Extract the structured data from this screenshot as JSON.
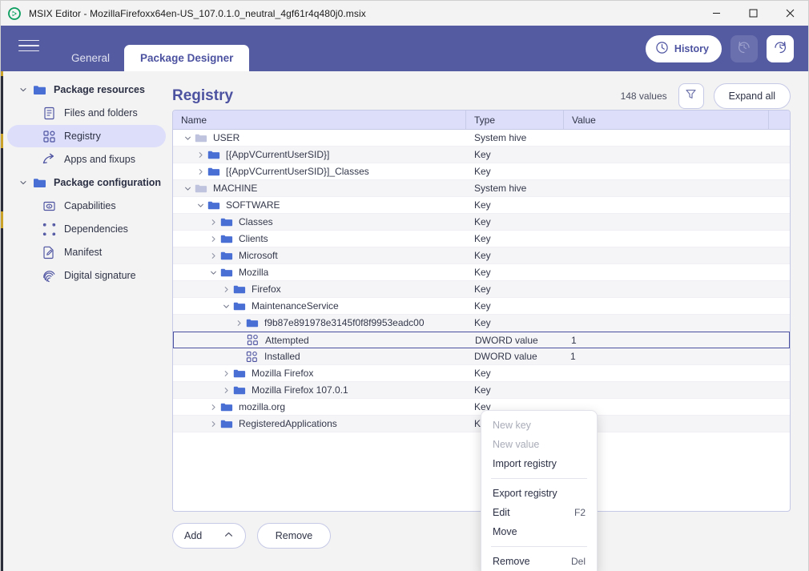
{
  "window": {
    "app_icon": "msix-logo-icon",
    "title": "MSIX Editor - MozillaFirefoxx64en-US_107.0.1.0_neutral_4gf61r4q480j0.msix",
    "minimize_label": "minimize-icon",
    "maximize_label": "maximize-icon",
    "close_label": "close-icon"
  },
  "header": {
    "menu_icon": "hamburger-icon",
    "tabs": [
      {
        "label": "General",
        "active": false
      },
      {
        "label": "Package Designer",
        "active": true
      }
    ],
    "history_label": "History",
    "history_icon": "clock-icon",
    "undo_icon": "undo-icon",
    "redo_icon": "redo-icon"
  },
  "sidebar": {
    "items": [
      {
        "label": "Package resources",
        "type": "group",
        "icon": "folder-icon",
        "expanded": true,
        "active": false
      },
      {
        "label": "Files and folders",
        "type": "child",
        "icon": "document-icon",
        "active": false
      },
      {
        "label": "Registry",
        "type": "child",
        "icon": "registry-icon",
        "active": true
      },
      {
        "label": "Apps and fixups",
        "type": "child",
        "icon": "arrow-branch-icon",
        "active": false
      },
      {
        "label": "Package configuration",
        "type": "group",
        "icon": "folder-icon",
        "expanded": true,
        "active": false
      },
      {
        "label": "Capabilities",
        "type": "child",
        "icon": "capabilities-icon",
        "active": false
      },
      {
        "label": "Dependencies",
        "type": "child",
        "icon": "dependencies-icon",
        "active": false
      },
      {
        "label": "Manifest",
        "type": "child",
        "icon": "manifest-edit-icon",
        "active": false
      },
      {
        "label": "Digital signature",
        "type": "child",
        "icon": "fingerprint-icon",
        "active": false
      }
    ]
  },
  "main": {
    "title": "Registry",
    "count_label": "148 values",
    "filter_icon": "funnel-icon",
    "expand_all_label": "Expand all",
    "columns": [
      "Name",
      "Type",
      "Value"
    ],
    "rows": [
      {
        "name": "USER",
        "type": "System hive",
        "value": "",
        "indent": 0,
        "twisty": "down",
        "icon": "hive-folder-icon",
        "selected": false
      },
      {
        "name": "[{AppVCurrentUserSID}]",
        "type": "Key",
        "value": "",
        "indent": 1,
        "twisty": "right",
        "icon": "key-folder-icon",
        "selected": false
      },
      {
        "name": "[{AppVCurrentUserSID}]_Classes",
        "type": "Key",
        "value": "",
        "indent": 1,
        "twisty": "right",
        "icon": "key-folder-icon",
        "selected": false
      },
      {
        "name": "MACHINE",
        "type": "System hive",
        "value": "",
        "indent": 0,
        "twisty": "down",
        "icon": "hive-folder-icon",
        "selected": false
      },
      {
        "name": "SOFTWARE",
        "type": "Key",
        "value": "",
        "indent": 1,
        "twisty": "down",
        "icon": "key-folder-icon",
        "selected": false
      },
      {
        "name": "Classes",
        "type": "Key",
        "value": "",
        "indent": 2,
        "twisty": "right",
        "icon": "key-folder-icon",
        "selected": false
      },
      {
        "name": "Clients",
        "type": "Key",
        "value": "",
        "indent": 2,
        "twisty": "right",
        "icon": "key-folder-icon",
        "selected": false
      },
      {
        "name": "Microsoft",
        "type": "Key",
        "value": "",
        "indent": 2,
        "twisty": "right",
        "icon": "key-folder-icon",
        "selected": false
      },
      {
        "name": "Mozilla",
        "type": "Key",
        "value": "",
        "indent": 2,
        "twisty": "down",
        "icon": "key-folder-icon",
        "selected": false
      },
      {
        "name": "Firefox",
        "type": "Key",
        "value": "",
        "indent": 3,
        "twisty": "right",
        "icon": "key-folder-icon",
        "selected": false
      },
      {
        "name": "MaintenanceService",
        "type": "Key",
        "value": "",
        "indent": 3,
        "twisty": "down",
        "icon": "key-folder-icon",
        "selected": false
      },
      {
        "name": "f9b87e891978e3145f0f8f9953eadc00",
        "type": "Key",
        "value": "",
        "indent": 4,
        "twisty": "right",
        "icon": "key-folder-icon",
        "selected": false
      },
      {
        "name": "Attempted",
        "type": "DWORD value",
        "value": "1",
        "indent": 4,
        "twisty": "none",
        "icon": "registry-value-icon",
        "selected": true
      },
      {
        "name": "Installed",
        "type": "DWORD value",
        "value": "1",
        "indent": 4,
        "twisty": "none",
        "icon": "registry-value-icon",
        "selected": false
      },
      {
        "name": "Mozilla Firefox",
        "type": "Key",
        "value": "",
        "indent": 3,
        "twisty": "right",
        "icon": "key-folder-icon",
        "selected": false
      },
      {
        "name": "Mozilla Firefox 107.0.1",
        "type": "Key",
        "value": "",
        "indent": 3,
        "twisty": "right",
        "icon": "key-folder-icon",
        "selected": false
      },
      {
        "name": "mozilla.org",
        "type": "Key",
        "value": "",
        "indent": 2,
        "twisty": "right",
        "icon": "key-folder-icon",
        "selected": false
      },
      {
        "name": "RegisteredApplications",
        "type": "Key",
        "value": "",
        "indent": 2,
        "twisty": "right",
        "icon": "key-folder-icon",
        "selected": false
      }
    ],
    "footer": {
      "add_label": "Add",
      "add_chevron_icon": "chevron-up-icon",
      "remove_label": "Remove"
    }
  },
  "context_menu": {
    "items": [
      {
        "label": "New key",
        "accel": "",
        "disabled": true,
        "separator_after": false
      },
      {
        "label": "New value",
        "accel": "",
        "disabled": true,
        "separator_after": false
      },
      {
        "label": "Import registry",
        "accel": "",
        "disabled": false,
        "separator_after": true
      },
      {
        "label": "Export registry",
        "accel": "",
        "disabled": false,
        "separator_after": false
      },
      {
        "label": "Edit",
        "accel": "F2",
        "disabled": false,
        "separator_after": false
      },
      {
        "label": "Move",
        "accel": "",
        "disabled": false,
        "separator_after": true
      },
      {
        "label": "Remove",
        "accel": "Del",
        "disabled": false,
        "separator_after": false
      }
    ]
  },
  "colors": {
    "brand_purple": "#555ba0",
    "accent": "#4c52a0",
    "selection_bg": "#dcdefa",
    "header_row_bg": "#dcdefa",
    "folder_blue": "#4a6fd4",
    "hive_gray": "#bfc3dd"
  }
}
